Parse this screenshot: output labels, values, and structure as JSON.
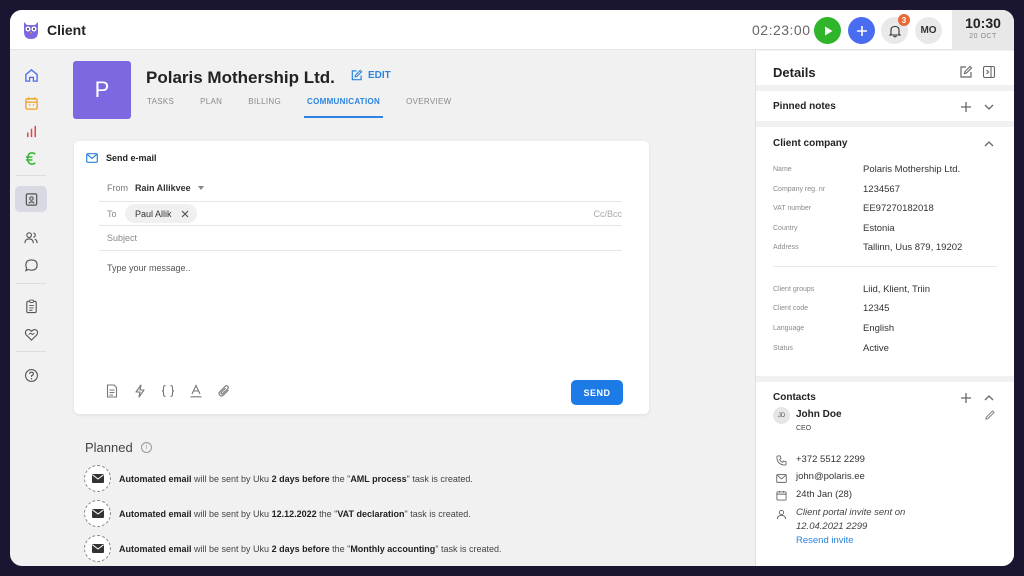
{
  "app": {
    "title": "Client"
  },
  "topbar": {
    "timer": "02:23:00",
    "notification_count": "3",
    "user_initials": "MO",
    "clock_time": "10:30",
    "clock_date": "20 OCT"
  },
  "sidebar": {
    "items": [
      {
        "name": "home-icon"
      },
      {
        "name": "calendar-icon"
      },
      {
        "name": "bar-chart-icon"
      },
      {
        "name": "euro-icon"
      },
      {
        "name": "contact-card-icon",
        "active": true
      },
      {
        "name": "users-icon"
      },
      {
        "name": "chat-icon"
      },
      {
        "name": "clipboard-icon"
      },
      {
        "name": "heart-handshake-icon"
      },
      {
        "name": "help-icon"
      }
    ],
    "colors": {
      "home": "#4a6cf0",
      "calendar": "#f0a020",
      "chart": "#e8414a",
      "euro": "#2fb52a"
    }
  },
  "client": {
    "initial": "P",
    "name": "Polaris Mothership Ltd.",
    "edit_label": "EDIT",
    "tabs": [
      "TASKS",
      "PLAN",
      "BILLING",
      "COMMUNICATION",
      "OVERVIEW"
    ],
    "active_tab": "COMMUNICATION"
  },
  "email": {
    "header": "Send e-mail",
    "from_label": "From",
    "from_value": "Rain Allikvee",
    "to_label": "To",
    "to_recipient": "Paul Allik",
    "cc_bcc": "Cc/Bcc",
    "subject_placeholder": "Subject",
    "message_placeholder": "Type your message..",
    "send_label": "SEND",
    "toolbar": [
      "document-icon",
      "lightning-icon",
      "braces-icon",
      "text-format-icon",
      "paperclip-icon"
    ]
  },
  "planned": {
    "title": "Planned",
    "items": [
      {
        "type": "Automated email",
        "mid": " will be sent by Uku ",
        "when": "2 days before",
        "pre": " the \"",
        "task": "AML process",
        "post": "\" task is created."
      },
      {
        "type": "Automated email",
        "mid": " will be sent by Uku ",
        "when": "12.12.2022",
        "pre": " the \"",
        "task": "VAT declaration",
        "post": "\" task is created."
      },
      {
        "type": "Automated email",
        "mid": " will be sent by Uku ",
        "when": "2 days before",
        "pre": " the \"",
        "task": "Monthly accounting",
        "post": "\" task is created."
      }
    ]
  },
  "details": {
    "title": "Details",
    "pinned_notes": "Pinned notes",
    "client_company": {
      "title": "Client company",
      "fields": [
        {
          "label": "Name",
          "value": "Polaris Mothership Ltd."
        },
        {
          "label": "Company reg. nr",
          "value": "1234567"
        },
        {
          "label": "VAT number",
          "value": "EE97270182018"
        },
        {
          "label": "Country",
          "value": "Estonia"
        },
        {
          "label": "Address",
          "value": "Tallinn, Uus 879, 19202"
        }
      ],
      "fields2": [
        {
          "label": "Client groups",
          "value": "Liid, Klient, Triin"
        },
        {
          "label": "Client code",
          "value": "12345"
        },
        {
          "label": "Language",
          "value": "English"
        },
        {
          "label": "Status",
          "value": "Active"
        }
      ]
    },
    "contacts": {
      "title": "Contacts",
      "initials": "JD",
      "name": "John Doe",
      "role": "CEO",
      "phone": "+372 5512 2299",
      "email": "john@polaris.ee",
      "birthday": "24th Jan (28)",
      "invite_line1": "Client portal invite sent on",
      "invite_line2": "12.04.2021 2299",
      "resend": "Resend invite"
    }
  }
}
